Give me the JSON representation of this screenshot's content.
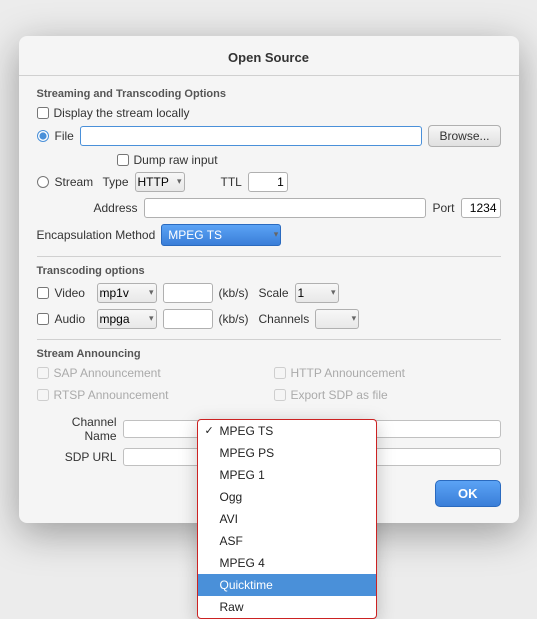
{
  "dialog": {
    "title": "Open Source"
  },
  "streaming": {
    "section_title": "Streaming and Transcoding Options",
    "display_stream_locally": "Display the stream locally",
    "file_label": "File",
    "browse_label": "Browse...",
    "dump_raw_input": "Dump raw input",
    "stream_label": "Stream",
    "type_label": "Type",
    "type_value": "HTTP",
    "ttl_label": "TTL",
    "ttl_value": "1",
    "address_label": "Address",
    "port_label": "Port",
    "port_value": "1234",
    "encap_label": "Encapsulation Method",
    "encap_value": "MPEG TS"
  },
  "dropdown": {
    "items": [
      {
        "label": "MPEG TS",
        "checked": true,
        "selected": false
      },
      {
        "label": "MPEG PS",
        "checked": false,
        "selected": false
      },
      {
        "label": "MPEG 1",
        "checked": false,
        "selected": false
      },
      {
        "label": "Ogg",
        "checked": false,
        "selected": false
      },
      {
        "label": "AVI",
        "checked": false,
        "selected": false
      },
      {
        "label": "ASF",
        "checked": false,
        "selected": false
      },
      {
        "label": "MPEG 4",
        "checked": false,
        "selected": false
      },
      {
        "label": "Quicktime",
        "checked": false,
        "selected": true
      },
      {
        "label": "Raw",
        "checked": false,
        "selected": false
      }
    ]
  },
  "transcoding": {
    "section_title": "Transcoding options",
    "video_label": "Video",
    "video_codec": "mp1v",
    "video_kbs": "(kb/s)",
    "video_scale": "Scale",
    "video_scale_val": "1",
    "audio_label": "Audio",
    "audio_codec": "mpga",
    "audio_kbs": "(kb/s)",
    "audio_channels": "Channels"
  },
  "announcing": {
    "section_title": "Stream Announcing",
    "sap_label": "SAP Announcement",
    "rtsp_label": "RTSP Announcement",
    "http_label": "HTTP Announcement",
    "export_label": "Export SDP as file",
    "channel_name_label": "Channel Name",
    "sdp_url_label": "SDP URL"
  },
  "footer": {
    "ok_label": "OK"
  }
}
